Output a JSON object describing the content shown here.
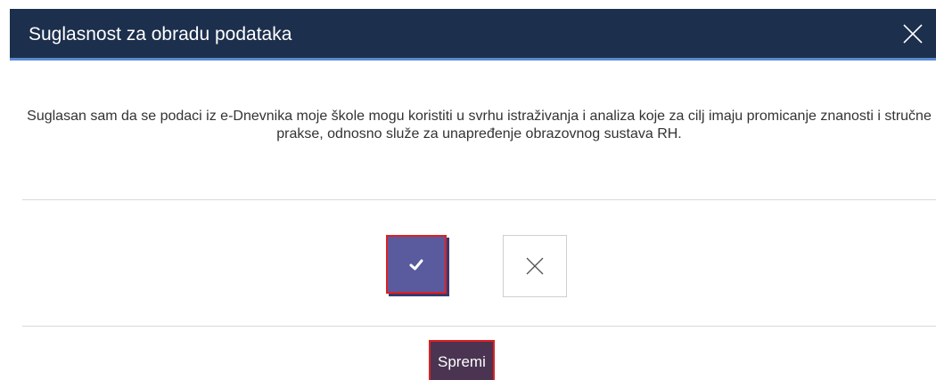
{
  "dialog": {
    "title": "Suglasnost za obradu podataka",
    "close_icon": "close-icon"
  },
  "body": {
    "text": "Suglasan sam da se podaci iz e-Dnevnika moje škole mogu koristiti u svrhu istraživanja i analiza koje za cilj imaju promicanje znanosti i stručne prakse, odnosno služe za unapređenje obrazovnog sustava RH."
  },
  "choices": {
    "yes_icon": "check-icon",
    "no_icon": "x-icon",
    "selected": "yes"
  },
  "footer": {
    "save_label": "Spremi"
  },
  "colors": {
    "header_bg": "#1c2f4d",
    "header_border": "#5a8bd0",
    "yes_bg": "#5a5a9e",
    "save_bg": "#4a3452",
    "highlight": "#e02020"
  }
}
